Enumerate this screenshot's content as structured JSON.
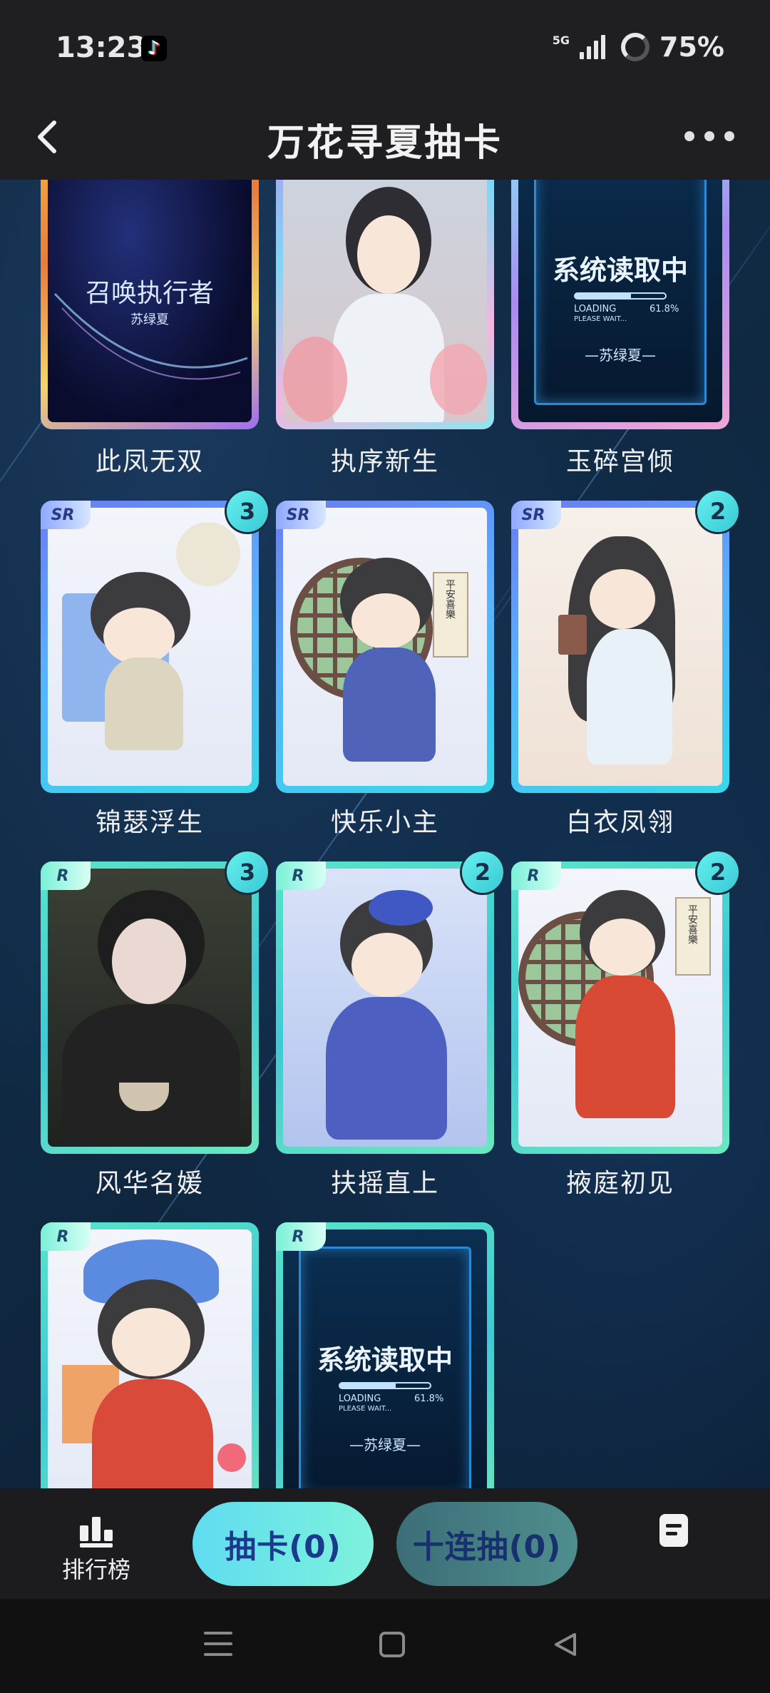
{
  "status": {
    "time": "13:23",
    "network": "5G",
    "battery": "75%"
  },
  "header": {
    "title": "万花寻夏抽卡"
  },
  "cards": [
    {
      "name": "此凤无双",
      "rarity": "",
      "count": "",
      "art_text": "召唤执行者",
      "art_sub": "苏绿夏"
    },
    {
      "name": "执序新生",
      "rarity": "",
      "count": ""
    },
    {
      "name": "玉碎宫倾",
      "rarity": "",
      "count": "",
      "art_text": "系统读取中",
      "loading": "LOADING",
      "percent": "61.8%",
      "wait": "PLEASE WAIT...",
      "art_sub": "—苏绿夏—"
    },
    {
      "name": "锦瑟浮生",
      "rarity": "SR",
      "count": "3"
    },
    {
      "name": "快乐小主",
      "rarity": "SR",
      "count": "",
      "scroll_text": "平安喜樂"
    },
    {
      "name": "白衣凤翎",
      "rarity": "SR",
      "count": "2"
    },
    {
      "name": "风华名媛",
      "rarity": "R",
      "count": "3"
    },
    {
      "name": "扶摇直上",
      "rarity": "R",
      "count": "2"
    },
    {
      "name": "掖庭初见",
      "rarity": "R",
      "count": "2",
      "scroll_text": "平安喜樂"
    },
    {
      "name": "",
      "rarity": "R",
      "count": ""
    },
    {
      "name": "",
      "rarity": "R",
      "count": "",
      "art_text": "系统读取中",
      "loading": "LOADING",
      "percent": "61.8%",
      "wait": "PLEASE WAIT...",
      "art_sub": "—苏绿夏—"
    }
  ],
  "actions": {
    "rank_label": "排行榜",
    "draw_one": "抽卡(0)",
    "draw_ten": "十连抽(0)"
  },
  "colors": {
    "accent": "#5fdcf0",
    "sr_frame": "#5ab0ff",
    "r_frame": "#58e4c8"
  },
  "icons": [
    "back-icon",
    "more-icon",
    "tiktok-icon",
    "signal-icon",
    "battery-icon",
    "rank-icon",
    "doc-icon",
    "nav-menu-icon",
    "nav-home-icon",
    "nav-back-icon"
  ]
}
